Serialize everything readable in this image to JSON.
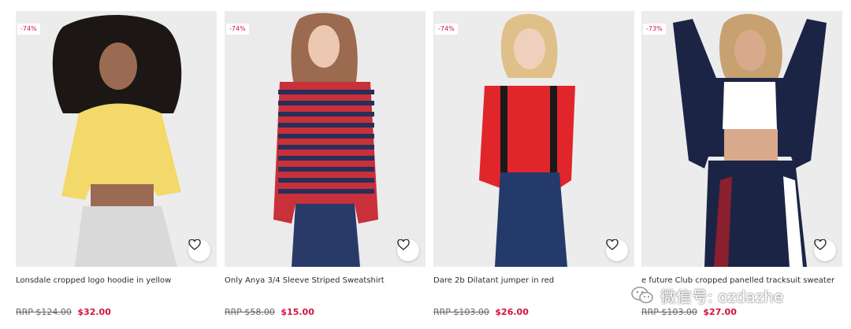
{
  "products": [
    {
      "discount": "-74%",
      "title": "Lonsdale cropped logo hoodie in yellow",
      "rrp": "RRP $124.00",
      "price": "$32.00",
      "colors": {
        "bg": "#ececec",
        "skin": "#9a6b52",
        "hair": "#1c1714",
        "top": "#f2d96a",
        "bottom": "#d9d9d9"
      }
    },
    {
      "discount": "-74%",
      "title": "Only Anya 3/4 Sleeve Striped Sweatshirt",
      "rrp": "RRP $58.00",
      "price": "$15.00",
      "colors": {
        "bg": "#ebebeb",
        "skin": "#ecc7b2",
        "hair": "#9b6a4f",
        "top": "#c8303a",
        "stripe": "#2a2f5a",
        "bottom": "#2a3a68"
      }
    },
    {
      "discount": "-74%",
      "title": "Dare 2b Dilatant jumper in red",
      "rrp": "RRP $103.00",
      "price": "$26.00",
      "colors": {
        "bg": "#ececec",
        "skin": "#efd0bd",
        "hair": "#e0c089",
        "top": "#e1262b",
        "bottom": "#243a6b",
        "strap": "#1a1a1a"
      }
    },
    {
      "discount": "-73%",
      "title": "e future Club cropped panelled tracksuit sweater",
      "rrp": "RRP $103.00",
      "price": "$27.00",
      "colors": {
        "bg": "#ececec",
        "skin": "#d9a98c",
        "hair": "#c7a170",
        "top": "#1c2446",
        "inner": "#ffffff",
        "bottom": "#1c2446",
        "accent": "#8a1f2e"
      }
    }
  ],
  "watermark": {
    "text": "微信号: ozdazhe",
    "icon": "wechat-icon"
  },
  "icons": {
    "favorite": "heart-icon"
  }
}
